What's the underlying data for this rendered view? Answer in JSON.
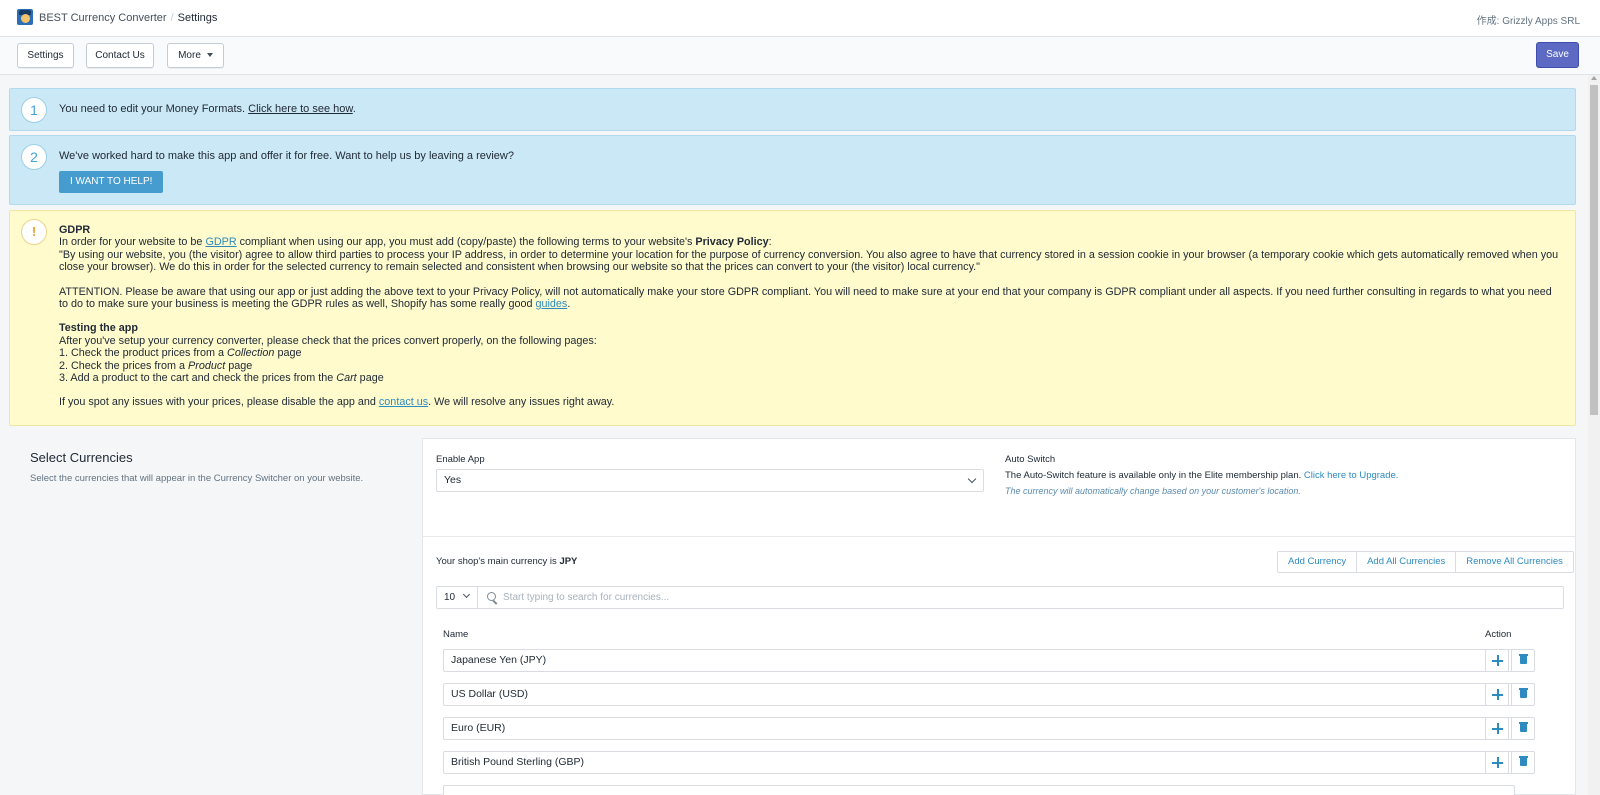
{
  "header": {
    "app_name": "BEST Currency Converter",
    "separator": "/",
    "page": "Settings",
    "byline": "作成: Grizzly Apps SRL"
  },
  "toolbar": {
    "settings_label": "Settings",
    "contact_label": "Contact Us",
    "more_label": "More",
    "save_label": "Save"
  },
  "notices": {
    "step1_number": "1",
    "step1_text": "You need to edit your Money Formats. ",
    "step1_link": "Click here to see how",
    "step1_end": ".",
    "step2_number": "2",
    "step2_text": "We've worked hard to make this app and offer it for free. Want to help us by leaving a review?",
    "step2_button": "I WANT TO HELP!"
  },
  "gdpr": {
    "icon": "!",
    "title": "GDPR",
    "p1_a": "In order for your website to be ",
    "p1_link": "GDPR",
    "p1_b": " compliant when using our app, you must add (copy/paste) the following terms to your website's ",
    "p1_bold": "Privacy Policy",
    "p1_c": ":",
    "quote": "\"By using our website, you (the visitor) agree to allow third parties to process your IP address, in order to determine your location for the purpose of currency conversion. You also agree to have that currency stored in a session cookie in your browser (a temporary cookie which gets automatically removed when you close your browser). We do this in order for the selected currency to remain selected and consistent when browsing our website so that the prices can convert to your (the visitor) local currency.\"",
    "attention": "ATTENTION. Please be aware that using our app or just adding the above text to your Privacy Policy, will not automatically make your store GDPR compliant. You will need to make sure at your end that your company is GDPR compliant under all aspects. If you need further consulting in regards to what you need to do to make sure your business is meeting the GDPR rules as well, Shopify has some really good ",
    "guides_link": "guides",
    "attention_end": ".",
    "testing_title": "Testing the app",
    "testing_intro": "After you've setup your currency converter, please check that the prices convert properly, on the following pages:",
    "step_1a": "1. Check the product prices from a ",
    "step_1b": "Collection",
    "step_1c": " page",
    "step_2a": "2. Check the prices from a ",
    "step_2b": "Product",
    "step_2c": " page",
    "step_3a": "3. Add a product to the cart and check the prices from the ",
    "step_3b": "Cart",
    "step_3c": " page",
    "issues_a": "If you spot any issues with your prices, please disable the app and ",
    "issues_link": "contact us",
    "issues_b": ". We will resolve any issues right away."
  },
  "select_currencies": {
    "title": "Select Currencies",
    "description": "Select the currencies that will appear in the Currency Switcher on your website."
  },
  "settings_card": {
    "enable_app_label": "Enable App",
    "enable_app_value": "Yes",
    "auto_switch_label": "Auto Switch",
    "auto_switch_text": "The Auto-Switch feature is available only in the Elite membership plan. ",
    "auto_switch_link": "Click here to Upgrade.",
    "auto_switch_note": "The currency will automatically change based on your customer's location.",
    "main_currency_text": "Your shop's main currency is ",
    "main_currency_code": "JPY",
    "add_currency": "Add Currency",
    "add_all": "Add All Currencies",
    "remove_all": "Remove All Currencies",
    "per_page": "10",
    "search_placeholder": "Start typing to search for currencies...",
    "col_name": "Name",
    "col_action": "Action",
    "rows": [
      "Japanese Yen (JPY)",
      "US Dollar (USD)",
      "Euro (EUR)",
      "British Pound Sterling (GBP)"
    ]
  },
  "colors": {
    "primary": "#5c6ac4",
    "info_bg": "#cbe8f6",
    "warning_bg": "#fffbcd",
    "link": "#2e8bc0",
    "help_button": "#479ccf"
  },
  "icons": [
    "app-logo-icon",
    "chevron-down-icon",
    "search-icon",
    "move-icon",
    "trash-icon",
    "warning-icon"
  ]
}
